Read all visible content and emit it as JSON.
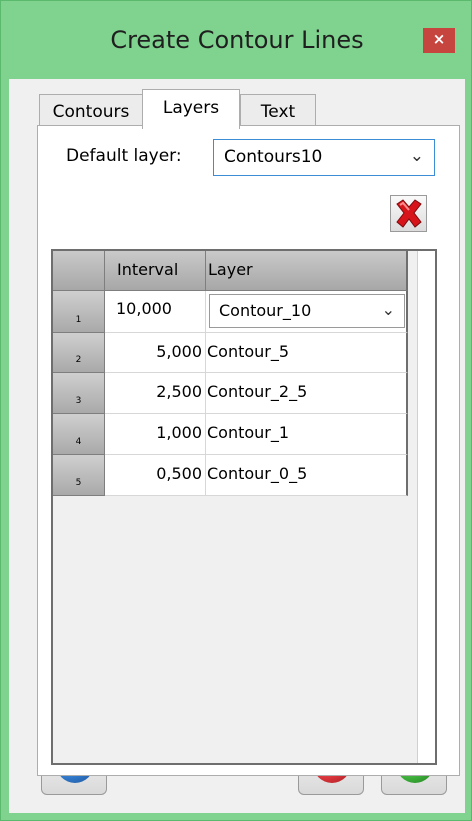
{
  "window": {
    "title": "Create Contour Lines",
    "close_glyph": "×"
  },
  "tabs": [
    {
      "label": "Contours"
    },
    {
      "label": "Layers"
    },
    {
      "label": "Text"
    }
  ],
  "layers_tab": {
    "default_layer_label": "Default layer:",
    "default_layer_value": "Contours10",
    "delete_icon": "red-x-delete-icon",
    "grid": {
      "columns": [
        "Interval",
        "Layer"
      ],
      "rows": [
        {
          "num": "1",
          "interval": "10,000",
          "layer": "Contour_10"
        },
        {
          "num": "2",
          "interval": "5,000",
          "layer": "Contour_5"
        },
        {
          "num": "3",
          "interval": "2,500",
          "layer": "Contour_2_5"
        },
        {
          "num": "4",
          "interval": "1,000",
          "layer": "Contour_1"
        },
        {
          "num": "5",
          "interval": "0,500",
          "layer": "Contour_0_5"
        }
      ]
    }
  },
  "footer": {
    "help_icon": "help-question-icon",
    "cancel_icon": "cancel-red-x-icon",
    "ok_icon": "ok-green-check-icon"
  },
  "colors": {
    "frame": "#7fd38f",
    "close": "#c7453f",
    "focus_border": "#3c8cd6",
    "help": "#2f77c8",
    "cancel": "#d9343a",
    "ok": "#3dae3a"
  }
}
